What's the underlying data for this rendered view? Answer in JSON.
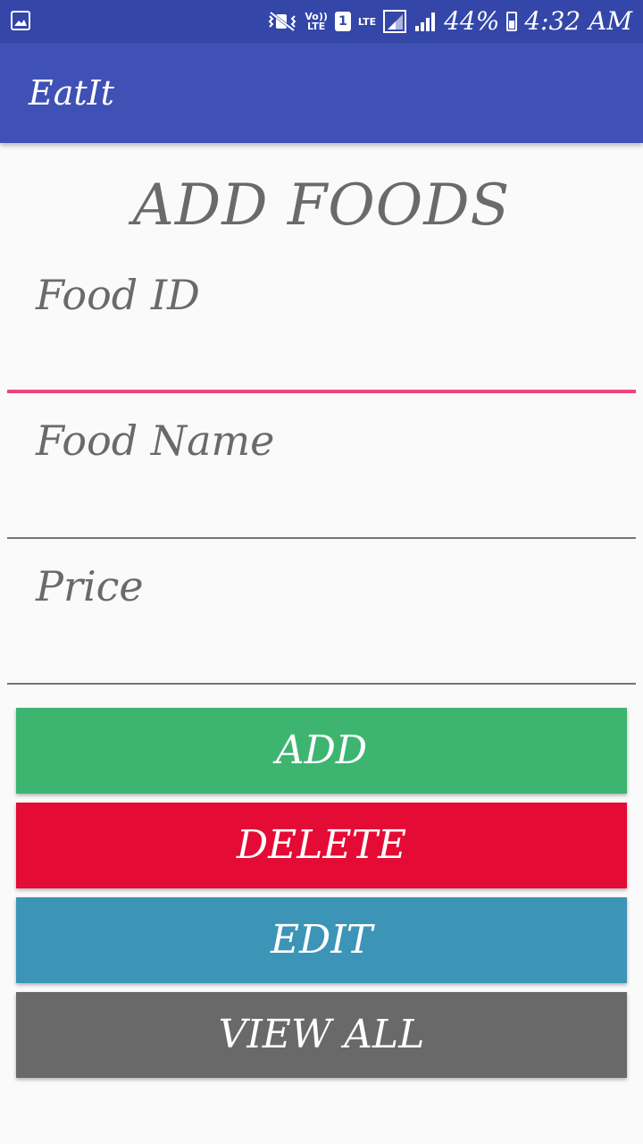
{
  "status_bar": {
    "volte_label": "Vo))\nLTE",
    "sim_label": "1",
    "lte_label": "LTE",
    "battery_percent": "44%",
    "time": "4:32 AM",
    "color": "#3446a8"
  },
  "app_bar": {
    "title": "EatIt",
    "color": "#3f51b5"
  },
  "page": {
    "heading": "ADD FOODS"
  },
  "form": {
    "food_id": {
      "placeholder": "Food ID",
      "value": "",
      "focused": true
    },
    "food_name": {
      "placeholder": "Food Name",
      "value": ""
    },
    "price": {
      "placeholder": "Price",
      "value": ""
    }
  },
  "buttons": {
    "add": {
      "label": "ADD",
      "color": "#3db571"
    },
    "delete": {
      "label": "DELETE",
      "color": "#e40b34"
    },
    "edit": {
      "label": "EDIT",
      "color": "#3c95b6"
    },
    "view_all": {
      "label": "VIEW ALL",
      "color": "#696969"
    }
  },
  "accent_color": "#f1447b"
}
